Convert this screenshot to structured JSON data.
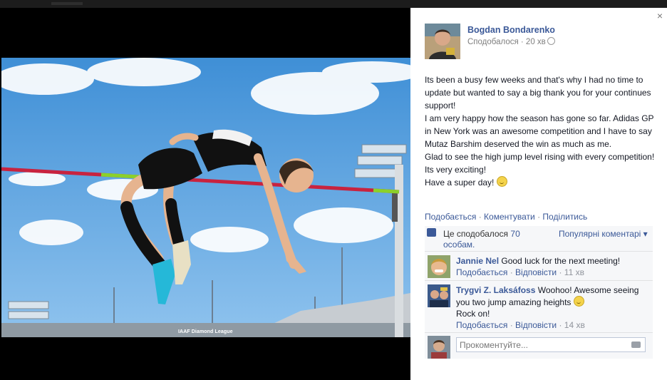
{
  "photo": {
    "caption": "IAAF Diamond League"
  },
  "panel": {
    "close_label": "×",
    "author": "Bogdan Bondarenko",
    "meta": "Сподобалося · 20 хв",
    "post_lines": [
      "Its been a busy few weeks and that's why I had no time to update but wanted to say a big thank you for your continues support!",
      "I am very happy how the season has gone so far. Adidas GP in New York was an awesome competition and I have to say Mutaz Barshim deserved the win as much as me.",
      "Glad to see the high jump level rising with every competition! Its very exciting!",
      "Have a super day!"
    ],
    "actions": {
      "like": "Подобається",
      "comment": "Коментувати",
      "share": "Поділитись",
      "sep": " · "
    },
    "likes": {
      "text": "Це сподобалося ",
      "count_link": "70 особам.",
      "top_comments": "Популярні коментарі ▾"
    },
    "comments": [
      {
        "name": "Jannie Nel",
        "text": "Good luck for the next meeting!",
        "like": "Подобається",
        "reply": "Відповісти",
        "time": "11 хв"
      },
      {
        "name": "Trygvi Z. Laksáfoss",
        "text": "Woohoo! Awesome seeing you two jump amazing heights",
        "text2": "Rock on!",
        "like": "Подобається",
        "reply": "Відповісти",
        "time": "14 хв"
      }
    ],
    "composer": {
      "placeholder": "Прокоментуйте..."
    }
  },
  "colors": {
    "link": "#3b5998",
    "panel_bg": "#ffffff",
    "ufi_bg": "#f6f7f9",
    "sky": "#5aa7e6"
  }
}
